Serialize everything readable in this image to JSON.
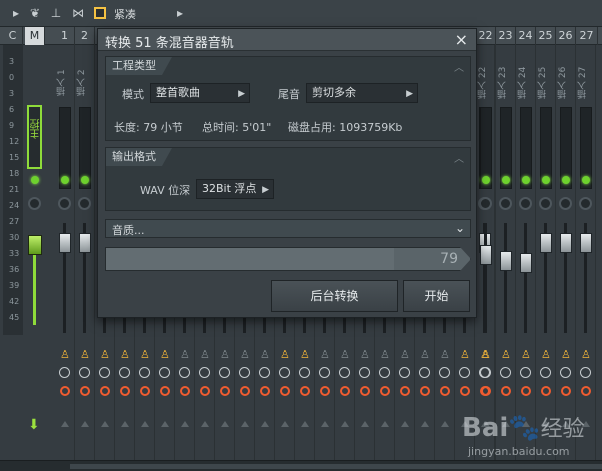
{
  "toolbar": {
    "mode_label": "紧凑"
  },
  "header": {
    "cells": [
      "C",
      "M",
      "1",
      "2",
      "22",
      "23",
      "24",
      "25",
      "26",
      "27"
    ]
  },
  "mixer": {
    "master_label": "主控",
    "left_strip_labels": [
      "插入 1",
      "插入 2"
    ],
    "right_strip_labels": [
      "插入 22",
      "插入 23",
      "插入 24",
      "插入 25",
      "插入 26",
      "插入 27"
    ],
    "ruler_marks": [
      "3",
      "0",
      "3",
      "6",
      "9",
      "12",
      "15",
      "18",
      "21",
      "24",
      "27",
      "30",
      "33",
      "36",
      "39",
      "42",
      "45"
    ]
  },
  "dialog": {
    "title": "转换 51 条混音器音轨",
    "close_glyph": "×",
    "project_section": {
      "title": "工程类型",
      "mode_label": "模式",
      "mode_value": "整首歌曲",
      "tail_label": "尾音",
      "tail_value": "剪切多余",
      "length": "长度: 79 小节",
      "total_time": "总时间: 5'01\"",
      "disk_usage": "磁盘占用: 1093759Kb"
    },
    "output_section": {
      "title": "输出格式",
      "wav_label": "WAV 位深",
      "wav_value": "32Bit 浮点"
    },
    "quality": {
      "label": "音质...",
      "slider_value": "79",
      "slider_fraction": 0.79
    },
    "buttons": {
      "background": "后台转换",
      "start": "开始"
    }
  },
  "watermark": {
    "brand": "Bai",
    "brand_cn": "经验",
    "url": "jingyan.baidu.com"
  },
  "colors": {
    "accent_green": "#8fdc3a",
    "accent_orange": "#f05c30",
    "accent_yellow": "#f5c243"
  }
}
